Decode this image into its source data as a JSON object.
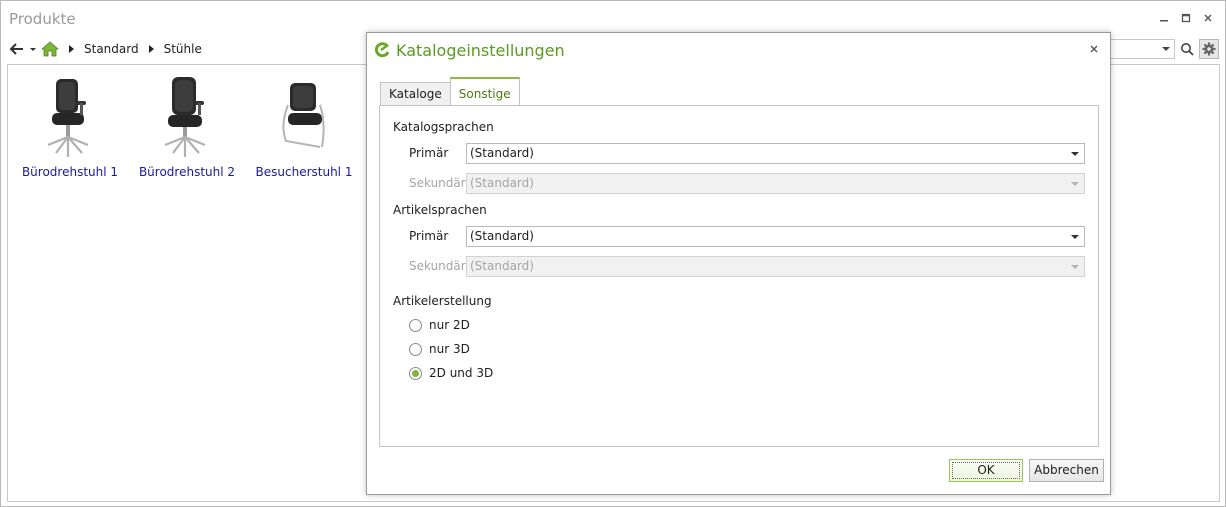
{
  "window": {
    "title": "Produkte"
  },
  "breadcrumb": {
    "items": [
      "Standard",
      "Stühle"
    ]
  },
  "products": [
    {
      "label": "Bürodrehstuhl 1"
    },
    {
      "label": "Bürodrehstuhl 2"
    },
    {
      "label": "Besucherstuhl 1"
    }
  ],
  "dialog": {
    "title": "Katalogeinstellungen",
    "tabs": [
      {
        "label": "Kataloge"
      },
      {
        "label": "Sonstige"
      }
    ],
    "active_tab": "Sonstige",
    "catalog_languages": {
      "label": "Katalogsprachen",
      "primary_label": "Primär",
      "primary_value": "(Standard)",
      "secondary_label": "Sekundär",
      "secondary_value": "(Standard)"
    },
    "article_languages": {
      "label": "Artikelsprachen",
      "primary_label": "Primär",
      "primary_value": "(Standard)",
      "secondary_label": "Sekundär",
      "secondary_value": "(Standard)"
    },
    "article_creation": {
      "label": "Artikelerstellung",
      "options": [
        {
          "label": "nur 2D",
          "checked": false
        },
        {
          "label": "nur 3D",
          "checked": false
        },
        {
          "label": "2D und 3D",
          "checked": true
        }
      ]
    },
    "ok_label": "OK",
    "cancel_label": "Abbrechen"
  },
  "colors": {
    "accent": "#7fb53a",
    "title_green": "#5a9a1e",
    "link_blue": "#1a1a9a"
  },
  "icons": [
    "back-arrow-icon",
    "dropdown-icon",
    "home-icon",
    "breadcrumb-arrow-icon",
    "search-icon",
    "gear-icon",
    "minimize-icon",
    "maximize-icon",
    "close-icon",
    "app-logo-icon"
  ]
}
